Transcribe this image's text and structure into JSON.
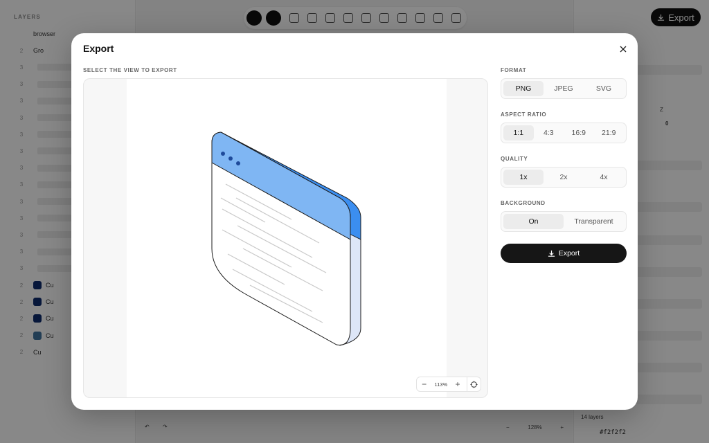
{
  "background": {
    "layers_title": "LAYERS",
    "layer_rows": [
      {
        "num": "",
        "label": "browser"
      },
      {
        "num": "2",
        "label": "Gro"
      },
      {
        "num": "3",
        "label": ""
      },
      {
        "num": "3",
        "label": ""
      },
      {
        "num": "3",
        "label": ""
      },
      {
        "num": "3",
        "label": ""
      },
      {
        "num": "3",
        "label": ""
      },
      {
        "num": "3",
        "label": ""
      },
      {
        "num": "3",
        "label": ""
      },
      {
        "num": "3",
        "label": ""
      },
      {
        "num": "3",
        "label": ""
      },
      {
        "num": "3",
        "label": ""
      },
      {
        "num": "3",
        "label": ""
      },
      {
        "num": "3",
        "label": ""
      },
      {
        "num": "3",
        "label": ""
      },
      {
        "num": "2",
        "label": "Cu"
      },
      {
        "num": "2",
        "label": "Cu"
      },
      {
        "num": "2",
        "label": "Cu"
      },
      {
        "num": "2",
        "label": "Cu"
      },
      {
        "num": "2",
        "label": "Cu"
      }
    ],
    "swatch_colors": [
      "#0d2a6b",
      "#0d2a6b",
      "#0d2a6b",
      "#3f6f9a"
    ],
    "top_export_label": "Export",
    "right_panel_z": "Z",
    "right_panel_value": "0",
    "layers_count": "14 layers",
    "hex_value": "#f2f2f2",
    "zoom_value": "128%"
  },
  "modal": {
    "title": "Export",
    "preview_label": "SELECT THE VIEW TO EXPORT",
    "zoom_value": "113%",
    "format": {
      "label": "FORMAT",
      "options": [
        "PNG",
        "JPEG",
        "SVG"
      ],
      "selected": "PNG"
    },
    "aspect_ratio": {
      "label": "ASPECT RATIO",
      "options": [
        "1:1",
        "4:3",
        "16:9",
        "21:9"
      ],
      "selected": "1:1"
    },
    "quality": {
      "label": "QUALITY",
      "options": [
        "1x",
        "2x",
        "4x"
      ],
      "selected": "1x"
    },
    "background": {
      "label": "BACKGROUND",
      "options": [
        "On",
        "Transparent"
      ],
      "selected": "On"
    },
    "export_label": "Export"
  },
  "colors": {
    "accent_blue": "#3b8ef0",
    "light_blue": "#7fb6f3",
    "side_blue": "#dde6f7",
    "dark_button": "#161616"
  }
}
